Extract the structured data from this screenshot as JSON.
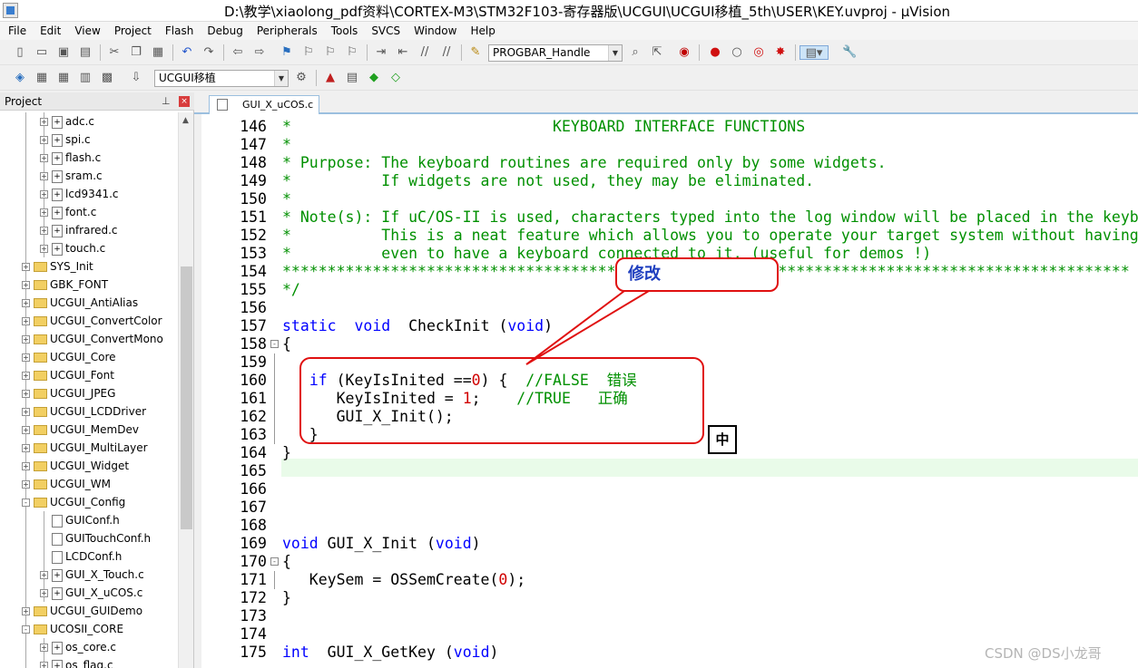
{
  "window": {
    "title": "D:\\教学\\xiaolong_pdf资料\\CORTEX-M3\\STM32F103-寄存器版\\UCGUI\\UCGUI移植_5th\\USER\\KEY.uvproj - µVision"
  },
  "menu": [
    "File",
    "Edit",
    "View",
    "Project",
    "Flash",
    "Debug",
    "Peripherals",
    "Tools",
    "SVCS",
    "Window",
    "Help"
  ],
  "toolbar": {
    "find_combo": "PROGBAR_Handle",
    "target_combo": "UCGUI移植"
  },
  "panel": {
    "title": "Project",
    "pin": "ᵖ",
    "close": "×"
  },
  "tree": [
    {
      "indent": 2,
      "pm": "+",
      "type": "file",
      "label": "adc.c"
    },
    {
      "indent": 2,
      "pm": "+",
      "type": "file",
      "label": "spi.c"
    },
    {
      "indent": 2,
      "pm": "+",
      "type": "file",
      "label": "flash.c"
    },
    {
      "indent": 2,
      "pm": "+",
      "type": "file",
      "label": "sram.c"
    },
    {
      "indent": 2,
      "pm": "+",
      "type": "file",
      "label": "lcd9341.c"
    },
    {
      "indent": 2,
      "pm": "+",
      "type": "file",
      "label": "font.c"
    },
    {
      "indent": 2,
      "pm": "+",
      "type": "file",
      "label": "infrared.c"
    },
    {
      "indent": 2,
      "pm": "+",
      "type": "file",
      "label": "touch.c"
    },
    {
      "indent": 1,
      "pm": "+",
      "type": "folder",
      "label": "SYS_Init"
    },
    {
      "indent": 1,
      "pm": "+",
      "type": "folder",
      "label": "GBK_FONT"
    },
    {
      "indent": 1,
      "pm": "+",
      "type": "folder",
      "label": "UCGUI_AntiAlias"
    },
    {
      "indent": 1,
      "pm": "+",
      "type": "folder",
      "label": "UCGUI_ConvertColor"
    },
    {
      "indent": 1,
      "pm": "+",
      "type": "folder",
      "label": "UCGUI_ConvertMono"
    },
    {
      "indent": 1,
      "pm": "+",
      "type": "folder",
      "label": "UCGUI_Core"
    },
    {
      "indent": 1,
      "pm": "+",
      "type": "folder",
      "label": "UCGUI_Font"
    },
    {
      "indent": 1,
      "pm": "+",
      "type": "folder",
      "label": "UCGUI_JPEG"
    },
    {
      "indent": 1,
      "pm": "+",
      "type": "folder",
      "label": "UCGUI_LCDDriver"
    },
    {
      "indent": 1,
      "pm": "+",
      "type": "folder",
      "label": "UCGUI_MemDev"
    },
    {
      "indent": 1,
      "pm": "+",
      "type": "folder",
      "label": "UCGUI_MultiLayer"
    },
    {
      "indent": 1,
      "pm": "+",
      "type": "folder",
      "label": "UCGUI_Widget"
    },
    {
      "indent": 1,
      "pm": "+",
      "type": "folder",
      "label": "UCGUI_WM"
    },
    {
      "indent": 1,
      "pm": "-",
      "type": "folder",
      "label": "UCGUI_Config"
    },
    {
      "indent": 2,
      "pm": "",
      "type": "file",
      "label": "GUIConf.h"
    },
    {
      "indent": 2,
      "pm": "",
      "type": "file",
      "label": "GUITouchConf.h"
    },
    {
      "indent": 2,
      "pm": "",
      "type": "file",
      "label": "LCDConf.h"
    },
    {
      "indent": 2,
      "pm": "+",
      "type": "file",
      "label": "GUI_X_Touch.c"
    },
    {
      "indent": 2,
      "pm": "+",
      "type": "file",
      "label": "GUI_X_uCOS.c"
    },
    {
      "indent": 1,
      "pm": "+",
      "type": "folder",
      "label": "UCGUI_GUIDemo"
    },
    {
      "indent": 1,
      "pm": "-",
      "type": "folder",
      "label": "UCOSII_CORE"
    },
    {
      "indent": 2,
      "pm": "+",
      "type": "file",
      "label": "os_core.c"
    },
    {
      "indent": 2,
      "pm": "+",
      "type": "file",
      "label": "os_flag.c"
    }
  ],
  "editor": {
    "tab": "GUI_X_uCOS.c",
    "lines": [
      {
        "n": "146",
        "fold": "",
        "p": [
          [
            "cm",
            "*                             KEYBOARD INTERFACE FUNCTIONS"
          ]
        ]
      },
      {
        "n": "147",
        "fold": "",
        "p": [
          [
            "cm",
            "*"
          ]
        ]
      },
      {
        "n": "148",
        "fold": "",
        "p": [
          [
            "cm",
            "* Purpose: The keyboard routines are required only by some widgets."
          ]
        ]
      },
      {
        "n": "149",
        "fold": "",
        "p": [
          [
            "cm",
            "*          If widgets are not used, they may be eliminated."
          ]
        ]
      },
      {
        "n": "150",
        "fold": "",
        "p": [
          [
            "cm",
            "*"
          ]
        ]
      },
      {
        "n": "151",
        "fold": "",
        "p": [
          [
            "cm",
            "* Note(s): If uC/OS-II is used, characters typed into the log window will be placed in the keyb"
          ]
        ]
      },
      {
        "n": "152",
        "fold": "",
        "p": [
          [
            "cm",
            "*          This is a neat feature which allows you to operate your target system without having"
          ]
        ]
      },
      {
        "n": "153",
        "fold": "",
        "p": [
          [
            "cm",
            "*          even to have a keyboard connected to it. (useful for demos !)"
          ]
        ]
      },
      {
        "n": "154",
        "fold": "",
        "p": [
          [
            "cm",
            "**********************************************************************************************"
          ]
        ]
      },
      {
        "n": "155",
        "fold": "",
        "p": [
          [
            "cm",
            "*/"
          ]
        ]
      },
      {
        "n": "156",
        "fold": "",
        "p": []
      },
      {
        "n": "157",
        "fold": "",
        "p": [
          [
            "kw",
            "static"
          ],
          [
            "",
            "  "
          ],
          [
            "kw",
            "void"
          ],
          [
            "",
            "  CheckInit ("
          ],
          [
            "kw",
            "void"
          ],
          [
            "",
            ")"
          ]
        ]
      },
      {
        "n": "158",
        "fold": "-",
        "p": [
          [
            "",
            "{"
          ]
        ]
      },
      {
        "n": "159",
        "fold": "",
        "p": []
      },
      {
        "n": "160",
        "fold": "",
        "p": [
          [
            "",
            "   "
          ],
          [
            "kw",
            "if"
          ],
          [
            "",
            " (KeyIsInited =="
          ],
          [
            "nm",
            "0"
          ],
          [
            "",
            ") {  "
          ],
          [
            "cm",
            "//FALSE  错误"
          ]
        ]
      },
      {
        "n": "161",
        "fold": "",
        "p": [
          [
            "",
            "      KeyIsInited = "
          ],
          [
            "nm",
            "1"
          ],
          [
            "",
            ";    "
          ],
          [
            "cm",
            "//TRUE   正确"
          ]
        ]
      },
      {
        "n": "162",
        "fold": "",
        "p": [
          [
            "",
            "      GUI_X_Init();"
          ]
        ]
      },
      {
        "n": "163",
        "fold": "",
        "p": [
          [
            "",
            "   }"
          ]
        ]
      },
      {
        "n": "164",
        "fold": "",
        "p": [
          [
            "",
            "}"
          ]
        ]
      },
      {
        "n": "165",
        "fold": "",
        "p": []
      },
      {
        "n": "166",
        "fold": "",
        "p": []
      },
      {
        "n": "167",
        "fold": "",
        "p": []
      },
      {
        "n": "168",
        "fold": "",
        "p": []
      },
      {
        "n": "169",
        "fold": "",
        "p": [
          [
            "kw",
            "void"
          ],
          [
            "",
            " GUI_X_Init ("
          ],
          [
            "kw",
            "void"
          ],
          [
            "",
            ")"
          ]
        ]
      },
      {
        "n": "170",
        "fold": "-",
        "p": [
          [
            "",
            "{"
          ]
        ]
      },
      {
        "n": "171",
        "fold": "",
        "p": [
          [
            "",
            "   KeySem = OSSemCreate("
          ],
          [
            "nm",
            "0"
          ],
          [
            "",
            ");"
          ]
        ]
      },
      {
        "n": "172",
        "fold": "",
        "p": [
          [
            "",
            "}"
          ]
        ]
      },
      {
        "n": "173",
        "fold": "",
        "p": []
      },
      {
        "n": "174",
        "fold": "",
        "p": []
      },
      {
        "n": "175",
        "fold": "",
        "p": [
          [
            "kw",
            "int"
          ],
          [
            "",
            "  GUI_X_GetKey ("
          ],
          [
            "kw",
            "void"
          ],
          [
            "",
            ")"
          ]
        ]
      }
    ]
  },
  "annotations": {
    "callout": "修改",
    "ime": "中",
    "watermark": "CSDN @DS小龙哥"
  }
}
